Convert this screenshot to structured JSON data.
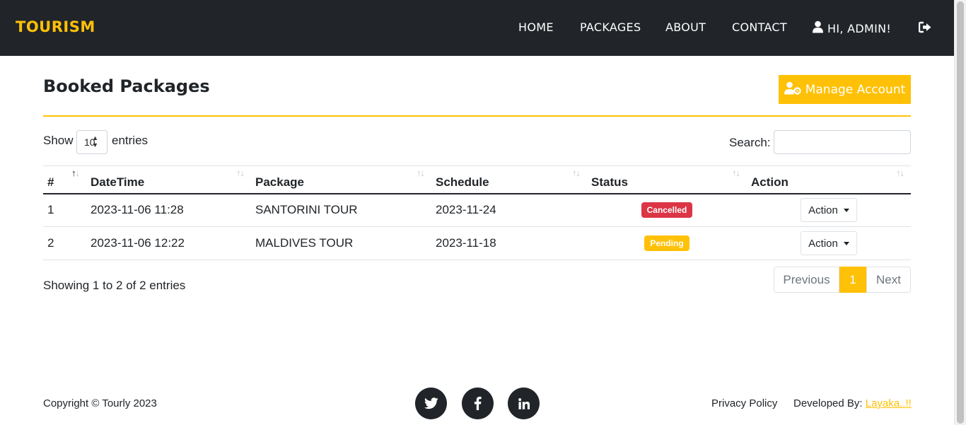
{
  "nav": {
    "brand": "TOURISM",
    "home": "HOME",
    "packages": "PACKAGES",
    "about": "ABOUT",
    "contact": "CONTACT",
    "user": "HI, ADMIN!",
    "user_icon": "user-icon",
    "logout_icon": "logout-icon"
  },
  "page": {
    "title": "Booked Packages",
    "manage_button": "Manage Account",
    "manage_icon": "user-gear-icon"
  },
  "table_controls": {
    "show_label": "Show",
    "entries_value": "10",
    "entries_label": "entries",
    "search_label": "Search:",
    "search_value": ""
  },
  "table": {
    "headers": [
      "#",
      "DateTime",
      "Package",
      "Schedule",
      "Status",
      "Action"
    ],
    "rows": [
      {
        "num": "1",
        "datetime": "2023-11-06 11:28",
        "package": "SANTORINI TOUR",
        "schedule": "2023-11-24",
        "status": "Cancelled",
        "status_color": "#dc3545",
        "action": "Action"
      },
      {
        "num": "2",
        "datetime": "2023-11-06 12:22",
        "package": "MALDIVES TOUR",
        "schedule": "2023-11-18",
        "status": "Pending",
        "status_color": "#ffc107",
        "action": "Action"
      }
    ]
  },
  "pagination": {
    "info": "Showing 1 to 2 of 2 entries",
    "previous": "Previous",
    "current": "1",
    "next": "Next"
  },
  "footer": {
    "copyright": "Copyright © Tourly 2023",
    "social_icons": [
      "twitter-icon",
      "facebook-icon",
      "linkedin-icon"
    ],
    "privacy": "Privacy Policy",
    "developed_by": "Developed By:",
    "developer": "Layaka..!!"
  },
  "colors": {
    "accent": "#ffc107",
    "navbar": "#212529",
    "danger": "#dc3545"
  }
}
